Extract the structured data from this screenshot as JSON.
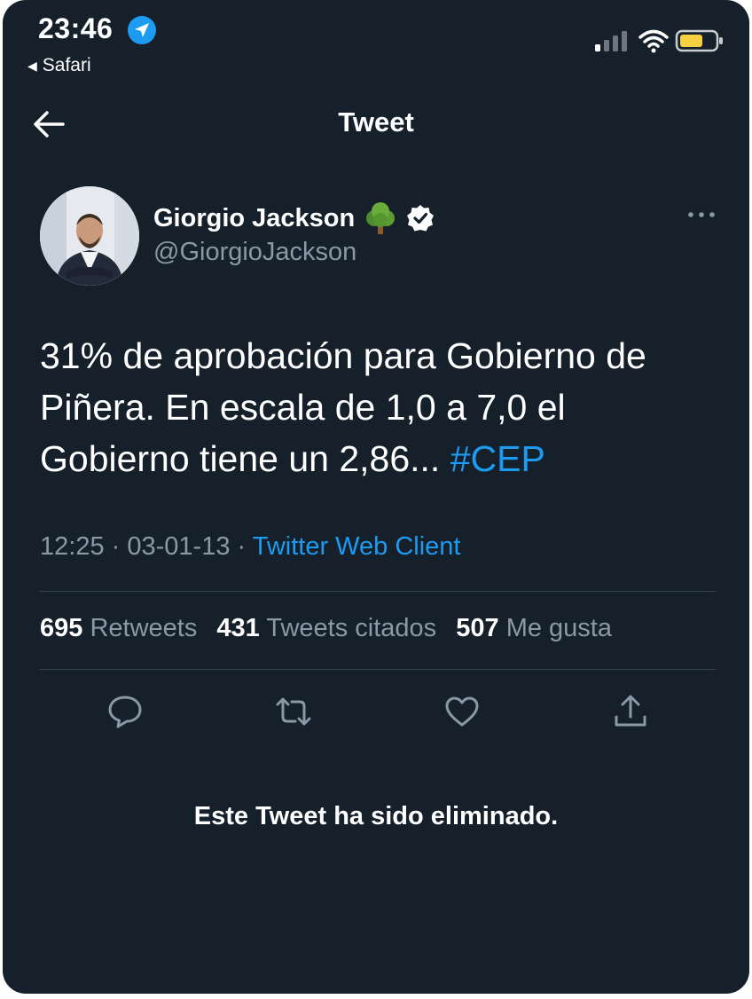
{
  "status_bar": {
    "time": "23:46",
    "back_app_label": "Safari",
    "location_icon": "location-arrow-icon",
    "signal_icon": "cellular-signal-icon",
    "wifi_icon": "wifi-icon",
    "battery_icon": "battery-icon"
  },
  "header": {
    "title": "Tweet",
    "back_icon": "back-arrow-icon"
  },
  "tweet": {
    "author_name": "Giorgio Jackson",
    "author_emoji": "🌳",
    "author_handle": "@GiorgioJackson",
    "text": "31% de aprobación para Gobierno de Piñera. En escala de 1,0 a 7,0 el Gobierno tiene un 2,86... ",
    "hashtag": "#CEP",
    "time": "12:25",
    "separator": " · ",
    "date": "03-01-13",
    "client": "Twitter Web Client",
    "stats": {
      "retweets_count": "695",
      "retweets_label": "Retweets",
      "quotes_count": "431",
      "quotes_label": "Tweets citados",
      "likes_count": "507",
      "likes_label": "Me gusta"
    }
  },
  "actions": [
    "reply-icon",
    "retweet-icon",
    "like-icon",
    "share-icon"
  ],
  "deleted_notice": "Este Tweet ha sido eliminado.",
  "colors": {
    "background": "#15202b",
    "accent": "#1d9bf0",
    "secondary_text": "#8b98a5",
    "divider": "#38444d",
    "battery": "#f5d142"
  }
}
